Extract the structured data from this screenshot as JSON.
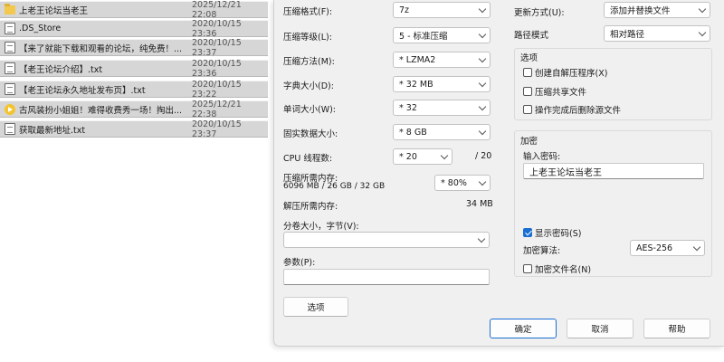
{
  "files": [
    {
      "icon": "folder-icon",
      "name": "上老王论坛当老王",
      "date": "2025/12/21 22:08"
    },
    {
      "icon": "document-icon",
      "name": ".DS_Store",
      "date": "2020/10/15 23:36"
    },
    {
      "icon": "document-icon",
      "name": "【来了就能下载和观看的论坛，纯免费！...",
      "date": "2020/10/15 23:37"
    },
    {
      "icon": "document-icon",
      "name": "【老王论坛介绍】.txt",
      "date": "2020/10/15 23:36"
    },
    {
      "icon": "document-icon",
      "name": "【老王论坛永久地址发布页】.txt",
      "date": "2020/10/15 23:22"
    },
    {
      "icon": "play-icon",
      "name": "古风装扮小姐姐！难得收费秀一场！掏出...",
      "date": "2025/12/21 22:38"
    },
    {
      "icon": "document-icon",
      "name": "获取最新地址.txt",
      "date": "2020/10/15 23:37"
    }
  ],
  "dialog": {
    "format_label": "压缩格式(F):",
    "format_value": "7z",
    "level_label": "压缩等级(L):",
    "level_value": "5 - 标准压缩",
    "method_label": "压缩方法(M):",
    "method_value": "* LZMA2",
    "dict_label": "字典大小(D):",
    "dict_value": "* 32 MB",
    "word_label": "单词大小(W):",
    "word_value": "* 32",
    "solid_label": "固实数据大小:",
    "solid_value": "* 8 GB",
    "cpu_label": "CPU 线程数:",
    "cpu_value": "* 20",
    "cpu_total": "/ 20",
    "mem_comp_label": "压缩所需内存:",
    "mem_comp_detail": "6096 MB / 26 GB / 32 GB",
    "mem_comp_value": "* 80%",
    "mem_decomp_label": "解压所需内存:",
    "mem_decomp_value": "34 MB",
    "split_label": "分卷大小，字节(V):",
    "split_value": "",
    "params_label": "参数(P):",
    "params_value": "",
    "options_button": "选项",
    "update_label": "更新方式(U):",
    "update_value": "添加并替换文件",
    "path_label": "路径模式",
    "path_value": "相对路径",
    "options_group_title": "选项",
    "opt_sfx": "创建自解压程序(X)",
    "opt_shared": "压缩共享文件",
    "opt_delete": "操作完成后删除源文件",
    "encrypt_group_title": "加密",
    "password_label": "输入密码:",
    "password_value": "上老王论坛当老王",
    "show_password": "显示密码(S)",
    "algo_label": "加密算法:",
    "algo_value": "AES-256",
    "encrypt_names": "加密文件名(N)",
    "ok_button": "确定",
    "cancel_button": "取消",
    "help_button": "帮助"
  },
  "colors": {
    "accent": "#1a6fd1",
    "selection_gray": "#d6d6d6",
    "dialog_bg": "#f0f0f0"
  }
}
